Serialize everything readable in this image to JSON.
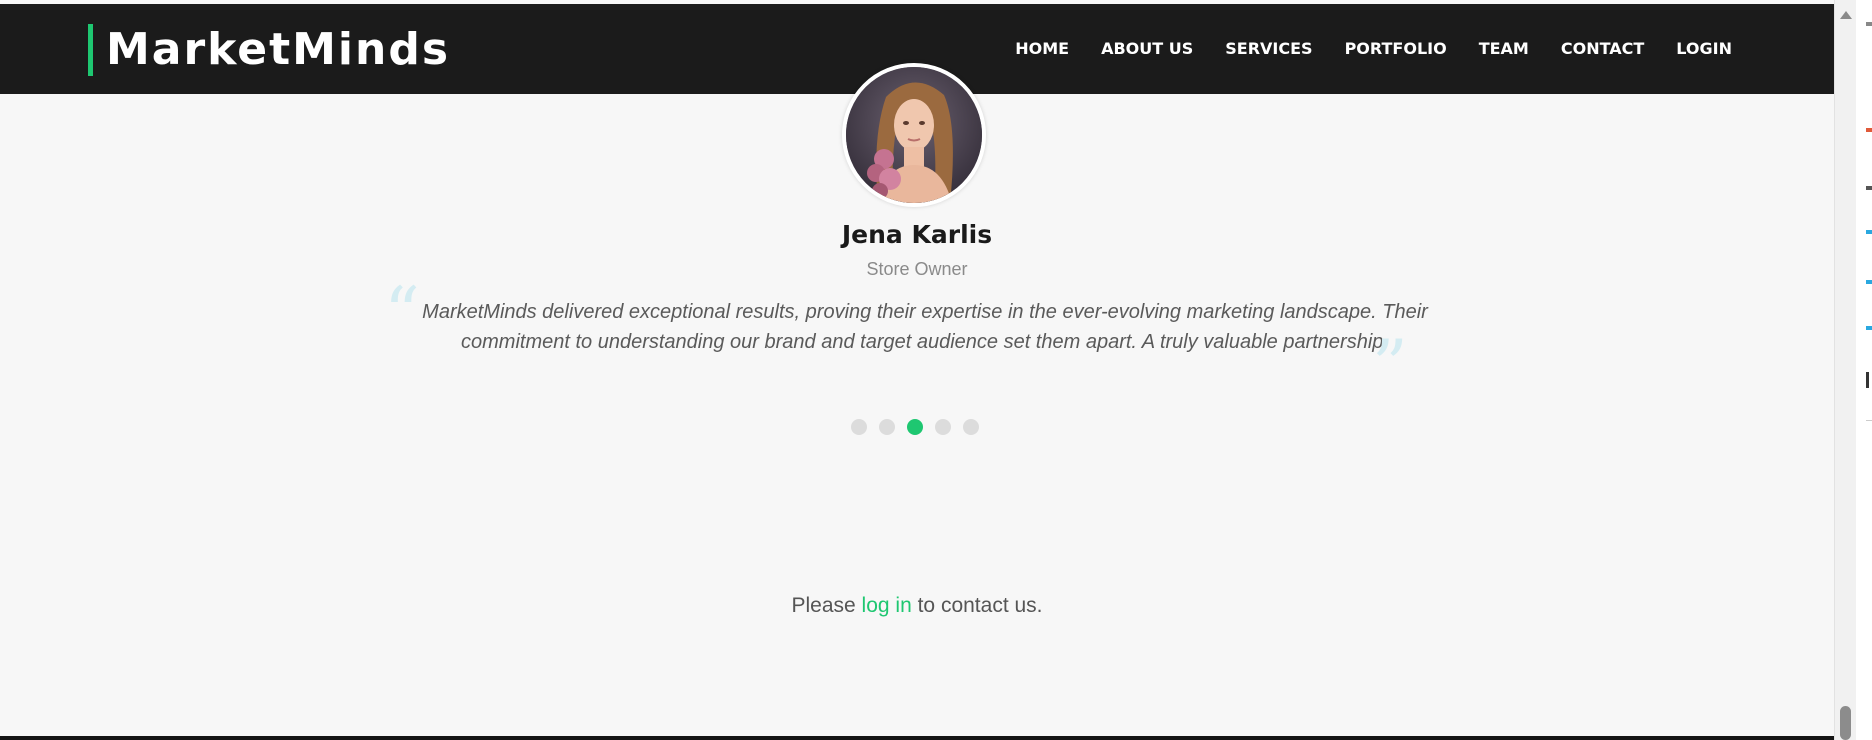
{
  "brand": {
    "name": "MarketMinds",
    "accent": "#1ec771"
  },
  "nav": {
    "items": [
      {
        "label": "HOME"
      },
      {
        "label": "ABOUT US"
      },
      {
        "label": "SERVICES"
      },
      {
        "label": "PORTFOLIO"
      },
      {
        "label": "TEAM"
      },
      {
        "label": "CONTACT"
      },
      {
        "label": "LOGIN"
      }
    ]
  },
  "testimonial": {
    "name": "Jena Karlis",
    "role": "Store Owner",
    "quote": "MarketMinds delivered exceptional results, proving their expertise in the ever-evolving marketing landscape. Their commitment to understanding our brand and target audience set them apart. A truly valuable partnership.",
    "open_mark": "“",
    "close_mark": "”",
    "avatar_icon": "portrait-photo",
    "slide_count": 5,
    "active_slide": 3
  },
  "contact": {
    "prefix": "Please",
    "link": "log in",
    "suffix": "to contact us."
  },
  "colors": {
    "navbar_bg": "#1b1b1b",
    "page_bg": "#f7f7f7",
    "accent": "#1ec771",
    "quote_marks": "#d4ecf2"
  }
}
